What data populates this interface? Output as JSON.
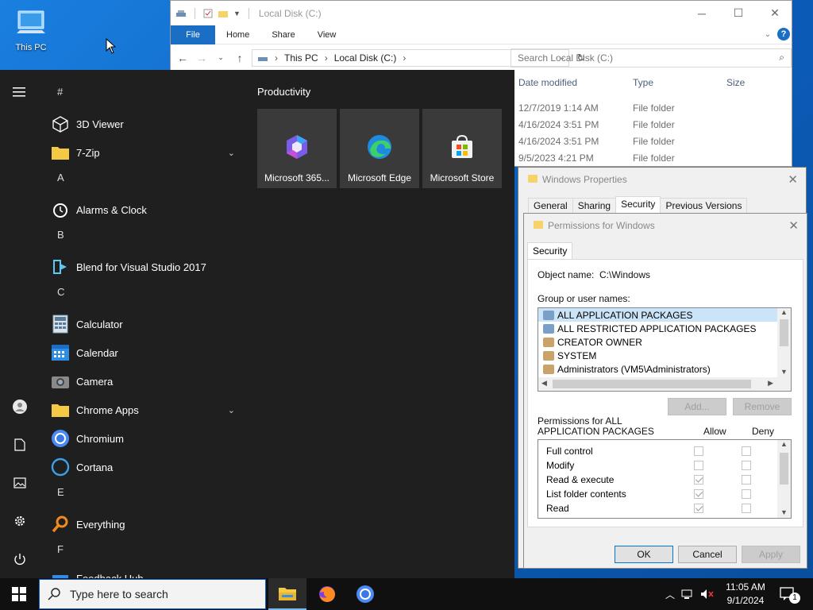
{
  "desktop": {
    "icon_label": "This PC"
  },
  "explorer": {
    "title": "Local Disk (C:)",
    "ribbon_tabs": [
      "File",
      "Home",
      "Share",
      "View"
    ],
    "breadcrumb": [
      "This PC",
      "Local Disk (C:)"
    ],
    "search_placeholder": "Search Local Disk (C:)",
    "columns": [
      "Date modified",
      "Type",
      "Size"
    ],
    "rows": [
      {
        "date": "12/7/2019 1:14 AM",
        "type": "File folder"
      },
      {
        "date": "4/16/2024 3:51 PM",
        "type": "File folder"
      },
      {
        "date": "4/16/2024 3:51 PM",
        "type": "File folder"
      },
      {
        "date": "9/5/2023 4:21 PM",
        "type": "File folder"
      }
    ]
  },
  "start_menu": {
    "letters": {
      "hash": "#",
      "a": "A",
      "b": "B",
      "c": "C",
      "e": "E",
      "f": "F"
    },
    "apps": {
      "viewer3d": "3D Viewer",
      "zip": "7-Zip",
      "alarms": "Alarms & Clock",
      "blend": "Blend for Visual Studio 2017",
      "calculator": "Calculator",
      "calendar": "Calendar",
      "camera": "Camera",
      "chromeapps": "Chrome Apps",
      "chromium": "Chromium",
      "cortana": "Cortana",
      "everything": "Everything",
      "feedback": "Feedback Hub"
    },
    "group_title": "Productivity",
    "tiles": [
      "Microsoft 365...",
      "Microsoft Edge",
      "Microsoft Store"
    ]
  },
  "props_dialog": {
    "title": "Windows Properties",
    "tabs": [
      "General",
      "Sharing",
      "Security",
      "Previous Versions"
    ]
  },
  "perm_dialog": {
    "title": "Permissions for Windows",
    "tab": "Security",
    "object_label": "Object name:",
    "object_value": "C:\\Windows",
    "group_label": "Group or user names:",
    "groups": [
      "ALL APPLICATION PACKAGES",
      "ALL RESTRICTED APPLICATION PACKAGES",
      "CREATOR OWNER",
      "SYSTEM",
      "Administrators (VM5\\Administrators)"
    ],
    "add": "Add...",
    "remove": "Remove",
    "perm_label_1": "Permissions for ALL",
    "perm_label_2": "APPLICATION PACKAGES",
    "allow": "Allow",
    "deny": "Deny",
    "perms": [
      "Full control",
      "Modify",
      "Read & execute",
      "List folder contents",
      "Read"
    ],
    "allowed": [
      false,
      false,
      true,
      true,
      true
    ],
    "ok": "OK",
    "cancel": "Cancel",
    "apply": "Apply"
  },
  "taskbar": {
    "search_placeholder": "Type here to search",
    "time": "11:05 AM",
    "date": "9/1/2024",
    "notif_count": "1"
  }
}
